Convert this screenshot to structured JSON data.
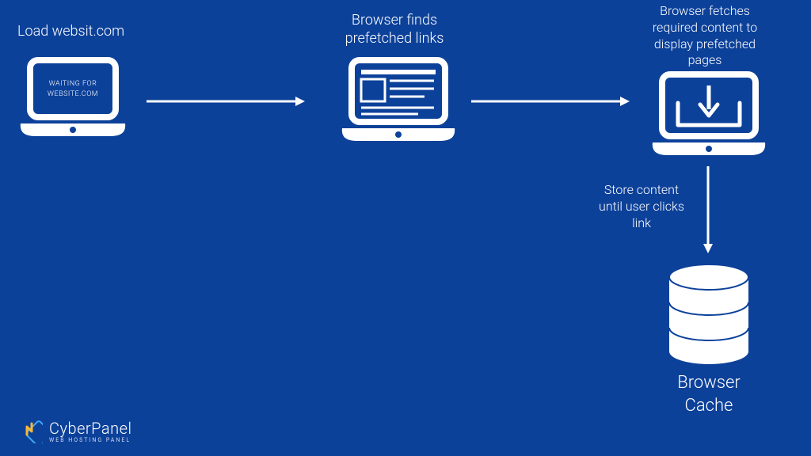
{
  "step1": {
    "title": "Load websit.com",
    "screen_l1": "WAITING FOR",
    "screen_l2": "WEBSITE.COM"
  },
  "step2": {
    "title_l1": "Browser finds",
    "title_l2": "prefetched links"
  },
  "step3": {
    "title_l1": "Browser fetches",
    "title_l2": "required content to",
    "title_l3": "display prefetched",
    "title_l4": "pages"
  },
  "transition34": {
    "l1": "Store content",
    "l2": "until user clicks",
    "l3": "link"
  },
  "cache": {
    "title_l1": "Browser",
    "title_l2": "Cache"
  },
  "brand": {
    "name": "CyberPanel",
    "tagline": "WEB HOSTING PANEL"
  }
}
